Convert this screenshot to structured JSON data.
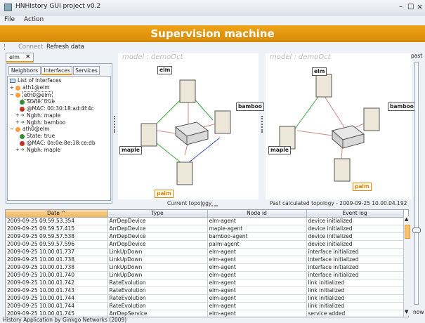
{
  "window": {
    "title": "HNHistory GUI project v0.2",
    "controls": [
      "–",
      "□",
      "×"
    ]
  },
  "menu": [
    "File",
    "Action"
  ],
  "banner": "Supervision machine",
  "toolbar": {
    "connect": "Connect",
    "refresh": "Refresh data"
  },
  "left": {
    "tab": "elm",
    "tab_close": "×",
    "subtabs": [
      "Neighbors",
      "Interfaces",
      "Services"
    ],
    "tree": [
      "List of interfaces",
      "ath1@elm",
      "eth0@elm",
      "State: true",
      "@MAC: 00:30:18:ad:4f:4c",
      "Ngbh: maple",
      "Ngbh: bamboo",
      "ath0@elm",
      "State: true",
      "@MAC: 0a:0e:8e:18:ce:db",
      "Ngbh: maple"
    ]
  },
  "topology_current": {
    "model": "model : demoOct",
    "caption": "Current topology",
    "nodes": [
      "elm",
      "bamboo",
      "maple",
      "palm"
    ],
    "links": [
      "Wifi",
      "Wifi",
      "Wifi",
      "Ethernet",
      "LinePlug",
      "LinePlug",
      "LinePlug",
      "LinePlug"
    ]
  },
  "topology_past": {
    "model": "model : demoOct",
    "caption": "Past calculated topology - 2009-09-25 10.00.04.192",
    "nodes": [
      "elm",
      "bamboo",
      "maple",
      "palm"
    ],
    "links": [
      "Wifi",
      "LinePlug",
      "LinePlug",
      "LinePlug",
      "LinePlug"
    ]
  },
  "slider": {
    "top": "past",
    "bottom": "now"
  },
  "table": {
    "columns": [
      "Date ^",
      "Type",
      "Node id",
      "Event log"
    ],
    "rows": [
      [
        "2009-09-25 09.59.53.354",
        "ArrDepDevice",
        "elm-agent",
        "device initialized"
      ],
      [
        "2009-09-25 09.59.57.415",
        "ArrDepDevice",
        "maple-agent",
        "device initialized"
      ],
      [
        "2009-09-25 09.59.57.538",
        "ArrDepDevice",
        "bamboo-agent",
        "device initialized"
      ],
      [
        "2009-09-25 09.59.57.596",
        "ArrDepDevice",
        "palm-agent",
        "device initialized"
      ],
      [
        "2009-09-25 10.00.01.737",
        "LinkUpDown",
        "elm-agent",
        "interface initialized"
      ],
      [
        "2009-09-25 10.00.01.738",
        "LinkUpDown",
        "elm-agent",
        "interface initialized"
      ],
      [
        "2009-09-25 10.00.01.738",
        "LinkUpDown",
        "elm-agent",
        "interface initialized"
      ],
      [
        "2009-09-25 10.00.01.740",
        "LinkUpDown",
        "elm-agent",
        "interface initialized"
      ],
      [
        "2009-09-25 10.00.01.742",
        "RateEvolution",
        "elm-agent",
        "link initialized"
      ],
      [
        "2009-09-25 10.00.01.743",
        "RateEvolution",
        "elm-agent",
        "link initialized"
      ],
      [
        "2009-09-25 10.00.01.744",
        "RateEvolution",
        "elm-agent",
        "link initialized"
      ],
      [
        "2009-09-25 10.00.01.744",
        "RateEvolution",
        "elm-agent",
        "link initialized"
      ],
      [
        "2009-09-25 10.00.01.745",
        "ArrDepService",
        "elm-agent",
        "service added"
      ]
    ]
  },
  "status": "History Application by Ginkgo Networks (2009)",
  "colors": {
    "accent": "#e49a1a",
    "banner": "#e29512",
    "link_wifi": "#3da83d",
    "link_eth": "#3b4fb8",
    "link_plug": "#d08a85"
  }
}
